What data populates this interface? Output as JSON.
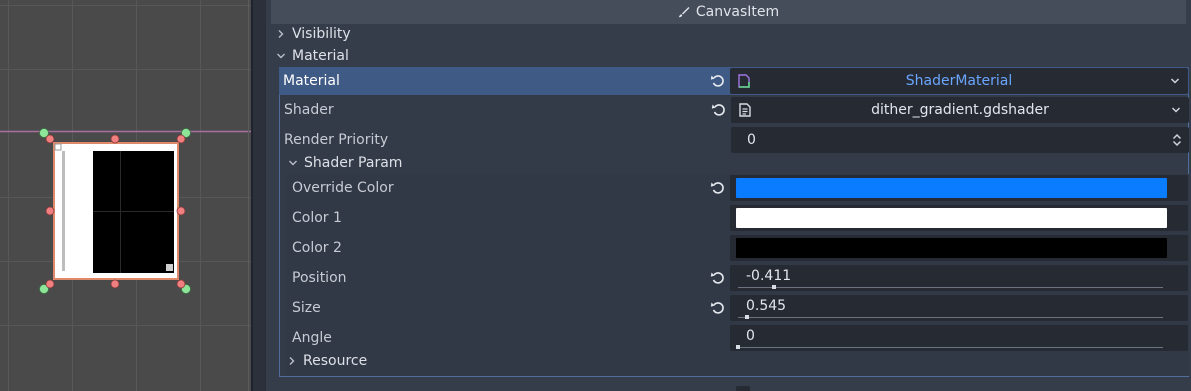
{
  "inspector": {
    "section_title": "CanvasItem",
    "section_icon": "brush-icon",
    "groups": {
      "visibility": "Visibility",
      "material": "Material"
    },
    "material": {
      "label": "Material",
      "value": "ShaderMaterial",
      "value_color": "#6aa5ff",
      "value_icon": "shader-material-icon"
    },
    "shader": {
      "label": "Shader",
      "value": "dither_gradient.gdshader",
      "value_icon": "file-icon"
    },
    "render_priority": {
      "label": "Render Priority",
      "value": "0"
    },
    "shader_param": {
      "label": "Shader Param",
      "override_color": {
        "label": "Override Color",
        "color": "#0a7cff"
      },
      "color_1": {
        "label": "Color 1",
        "color": "#ffffff"
      },
      "color_2": {
        "label": "Color 2",
        "color": "#000000"
      },
      "position": {
        "label": "Position",
        "value": "-0.411"
      },
      "size": {
        "label": "Size",
        "value": "0.545"
      },
      "angle": {
        "label": "Angle",
        "value": "0"
      },
      "resource": "Resource"
    }
  },
  "colors": {
    "accent": "#3f5a85",
    "selection_outline": "#e0886a",
    "handle_red": "#f07f7f",
    "handle_green": "#8ee59a"
  }
}
